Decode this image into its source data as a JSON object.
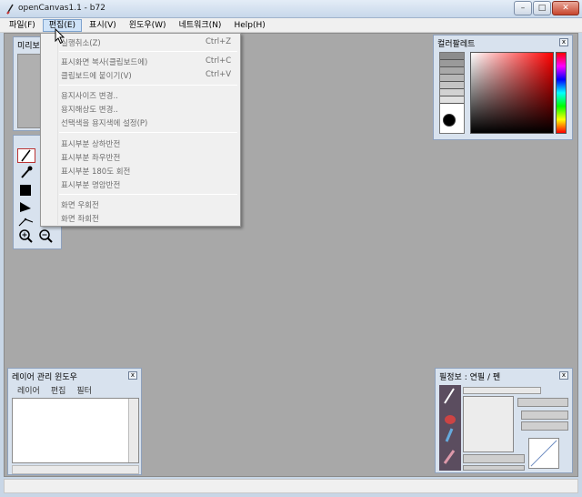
{
  "window": {
    "title": "openCanvas1.1  -  b72",
    "min_glyph": "–",
    "max_glyph": "□",
    "close_glyph": "✕"
  },
  "menubar": {
    "items": [
      {
        "label": "파일(F)"
      },
      {
        "label": "편집(E)"
      },
      {
        "label": "표시(V)"
      },
      {
        "label": "윈도우(W)"
      },
      {
        "label": "네트워크(N)"
      },
      {
        "label": "Help(H)"
      }
    ],
    "active_index": 1
  },
  "edit_menu": {
    "items": [
      {
        "label": "실행취소(Z)",
        "shortcut": "Ctrl+Z"
      },
      {
        "label": "표시화면 복사(클립보드에)",
        "shortcut": "Ctrl+C"
      },
      {
        "label": "클립보드에 붙이기(V)",
        "shortcut": "Ctrl+V"
      },
      {
        "label": "용지사이즈 변경..",
        "shortcut": ""
      },
      {
        "label": "용지해상도 변경..",
        "shortcut": ""
      },
      {
        "label": "선택색을 용지색에 설정(P)",
        "shortcut": ""
      },
      {
        "label": "표시부분 상하반전",
        "shortcut": ""
      },
      {
        "label": "표시부분 좌우반전",
        "shortcut": ""
      },
      {
        "label": "표시부분 180도 회전",
        "shortcut": ""
      },
      {
        "label": "표시부분 명암반전",
        "shortcut": ""
      },
      {
        "label": "화면 우회전",
        "shortcut": ""
      },
      {
        "label": "화면 좌회전",
        "shortcut": ""
      }
    ]
  },
  "preview_panel": {
    "title": "미리보"
  },
  "palette_panel": {
    "title": "컬러팔레트",
    "close": "x",
    "fg_color": "#000000",
    "hue": "#ff0000"
  },
  "layer_panel": {
    "title": "레이어 관리 윈도우",
    "close": "x",
    "tabs": [
      "레이어",
      "편집",
      "필터"
    ]
  },
  "brush_panel": {
    "title": "필정보 : 연필  /  펜",
    "close": "x"
  },
  "colors": {
    "workspace": "#a8a8a8",
    "menu_highlight": "#cfe3f8"
  }
}
